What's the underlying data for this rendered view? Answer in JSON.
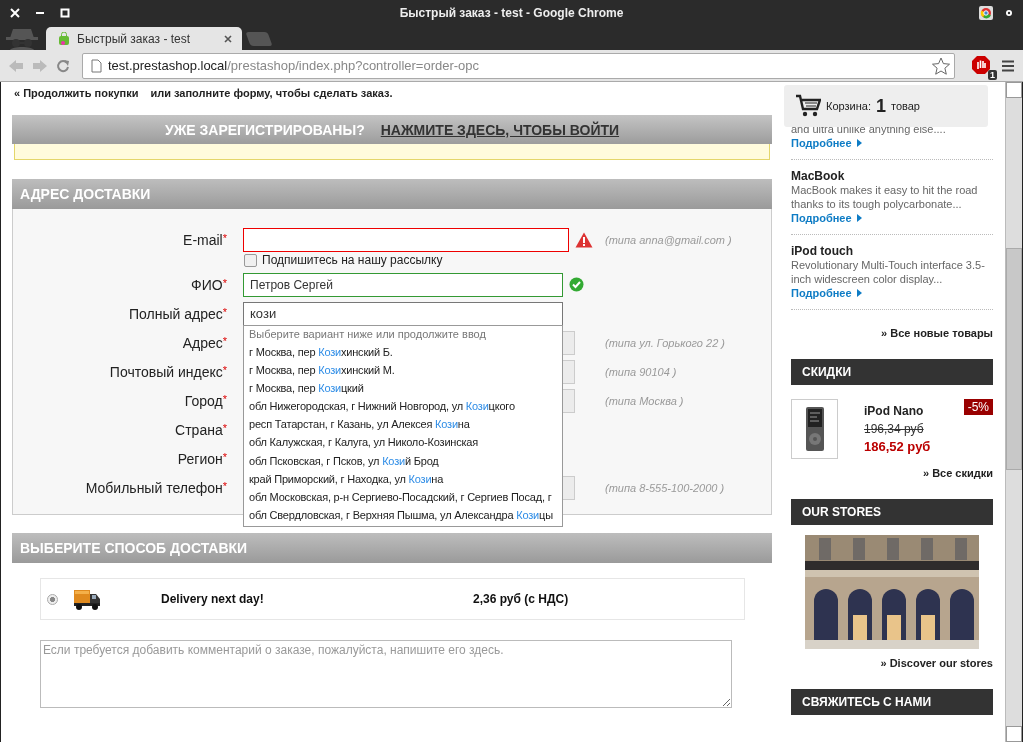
{
  "window": {
    "title": "Быстрый заказ - test - Google Chrome"
  },
  "tabs": [
    {
      "label": "Быстрый заказ - test",
      "selected": true
    }
  ],
  "address_bar": {
    "host": "test.prestashop.local",
    "path": "/prestashop/index.php?controller=order-opc"
  },
  "extension_badge": "1",
  "page": {
    "continue_line": {
      "link": "« Продолжить покупки",
      "text": "или заполните форму, чтобы сделать заказ."
    },
    "login_bar": {
      "question": "УЖЕ ЗАРЕГИСТРИРОВАНЫ?",
      "link": "НАЖМИТЕ ЗДЕСЬ, ЧТОБЫ ВОЙТИ"
    },
    "address_section": {
      "title": "АДРЕС ДОСТАВКИ",
      "fields": [
        {
          "label": "E-mail",
          "required_mark": "*",
          "kind": "input",
          "error": true,
          "valid": false,
          "focused": false,
          "hint": "(типа anna@gmail.com )"
        },
        {
          "kind": "checkbox",
          "label": "Подпишитесь на нашу рассылку",
          "checked": false
        },
        {
          "label": "ФИО",
          "required_mark": "*",
          "kind": "input",
          "error": false,
          "valid": true,
          "focused": false,
          "value": "Петров Сергей"
        },
        {
          "label": "Полный адрес",
          "required_mark": "*",
          "kind": "input",
          "error": false,
          "valid": false,
          "focused": true,
          "value": "кози"
        },
        {
          "label": "Адрес",
          "required_mark": "*",
          "kind": "input",
          "error": false,
          "valid": false,
          "focused": false,
          "hint": "(типа ул. Горького 22 )"
        },
        {
          "label": "Почтовый индекс",
          "required_mark": "*",
          "kind": "input",
          "error": false,
          "valid": false,
          "focused": false,
          "hint": "(типа 90104 )"
        },
        {
          "label": "Город",
          "required_mark": "*",
          "kind": "input",
          "error": false,
          "valid": false,
          "focused": false,
          "hint": "(типа Москва )"
        },
        {
          "label": "Страна",
          "required_mark": "*",
          "kind": "select"
        },
        {
          "label": "Регион",
          "required_mark": "*",
          "kind": "select"
        },
        {
          "label": "Мобильный телефон",
          "required_mark": "*",
          "kind": "input",
          "error": false,
          "valid": false,
          "focused": false,
          "hint": "(типа 8-555-100-2000 )"
        }
      ],
      "autocomplete": {
        "header": "Выберите вариант ниже или продолжите ввод",
        "suggestions": [
          {
            "before": "г Москва, пер ",
            "match": "Кози",
            "after": "хинский Б."
          },
          {
            "before": "г Москва, пер ",
            "match": "Кози",
            "after": "хинский М."
          },
          {
            "before": "г Москва, пер ",
            "match": "Кози",
            "after": "цкий"
          },
          {
            "before": "обл Нижегородская, г Нижний Новгород, ул ",
            "match": "Кози",
            "after": "цкого"
          },
          {
            "before": "респ Татарстан, г Казань, ул Алексея ",
            "match": "Кози",
            "after": "на"
          },
          {
            "before": "обл Калужская, г Калуга, ул Николо-Козинская"
          },
          {
            "before": "обл Псковская, г Псков, ул ",
            "match": "Кози",
            "after": "й Брод"
          },
          {
            "before": "край Приморский, г Находка, ул ",
            "match": "Кози",
            "after": "на"
          },
          {
            "before": "обл Московская, р-н Сергиево-Посадский, г Сергиев Посад, г"
          },
          {
            "before": "обл Свердловская, г Верхняя Пышма, ул Александра ",
            "match": "Кози",
            "after": "цы"
          }
        ]
      }
    },
    "delivery_section": {
      "title": "ВЫБЕРИТЕ СПОСОБ ДОСТАВКИ",
      "carriers": [
        {
          "name": "Delivery next day!",
          "price": "2,36 руб (с НДС)",
          "selected": true
        }
      ],
      "comment": {
        "placeholder": "Если требуется добавить комментарий о заказе, пожалуйста, напишите его здесь."
      }
    }
  },
  "sidebar": {
    "cart": {
      "label": "Корзина:",
      "count": "1",
      "unit": "товар"
    },
    "new_products": {
      "items": [
        {
          "description": "and ultra unlike anything else....",
          "link": "Подробнее"
        },
        {
          "name": "MacBook",
          "description": "MacBook makes it easy to hit the road thanks to its tough polycarbonate...",
          "link": "Подробнее"
        },
        {
          "name": "iPod touch",
          "description": "Revolutionary Multi-Touch interface 3.5-inch widescreen color display...",
          "link": "Подробнее"
        }
      ],
      "all_link": "» Все новые товары"
    },
    "specials": {
      "title": "СКИДКИ",
      "product": {
        "name": "iPod Nano",
        "old_price": "196,34 руб",
        "price": "186,52 руб",
        "discount": "-5%"
      },
      "all_link": "» Все скидки"
    },
    "stores": {
      "title": "OUR STORES",
      "link": "» Discover our stores"
    },
    "contact": {
      "title": "СВЯЖИТЕСЬ С НАМИ"
    }
  }
}
